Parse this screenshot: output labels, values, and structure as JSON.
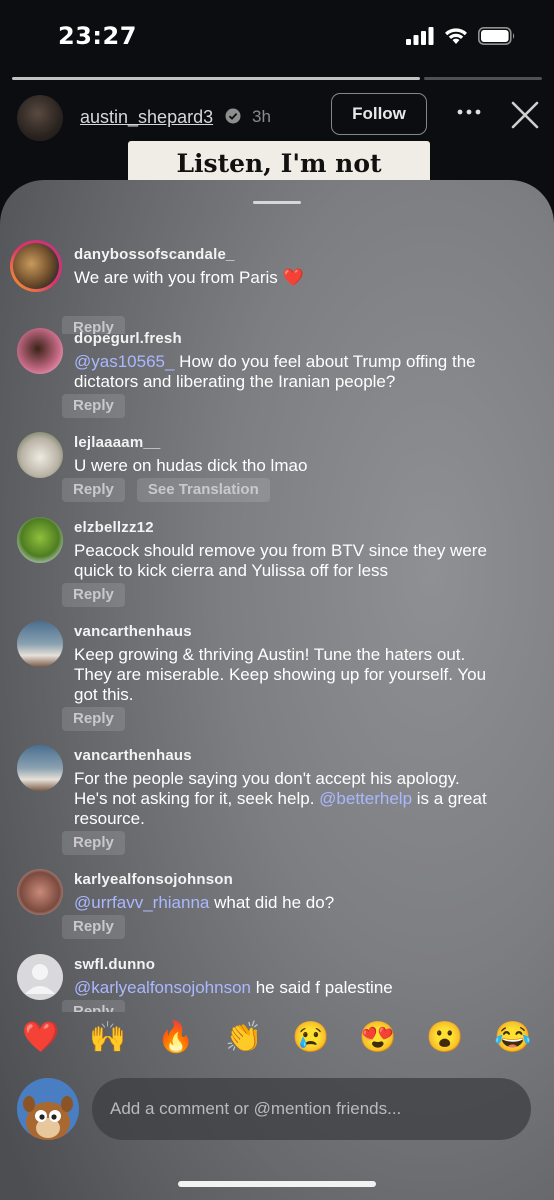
{
  "status_bar": {
    "time": "23:27"
  },
  "story": {
    "username": "austin_shepard3",
    "age": "3h",
    "follow_label": "Follow",
    "card_text": "Listen, I'm not perfect."
  },
  "comments": [
    {
      "user": "danybossofscandale_",
      "mention": "",
      "text": "We are with you from Paris ❤️",
      "reply": "Reply",
      "translate": ""
    },
    {
      "user": "dopegurl.fresh",
      "mention": "@yas10565_",
      "text": " How do you feel about Trump offing the dictators and liberating the Iranian people?",
      "reply": "Reply",
      "translate": ""
    },
    {
      "user": "lejlaaaam__",
      "mention": "",
      "text": "U were on hudas dick tho lmao",
      "reply": "Reply",
      "translate": "See Translation"
    },
    {
      "user": "elzbellzz12",
      "mention": "",
      "text": "Peacock should remove you from BTV since they were quick to kick cierra and Yulissa off for less",
      "reply": "Reply",
      "translate": ""
    },
    {
      "user": "vancarthenhaus",
      "mention": "",
      "text": "Keep growing & thriving Austin! Tune the haters out. They are miserable. Keep showing up for yourself. You got this.",
      "reply": "Reply",
      "translate": ""
    },
    {
      "user": "vancarthenhaus",
      "mention": "",
      "text": "For the people saying you don't accept his apology. He's not asking for it, seek help. ",
      "mention2": "@betterhelp",
      "text2": " is a great resource.",
      "reply": "Reply",
      "translate": ""
    },
    {
      "user": "karlyealfonsojohnson",
      "mention": "@urrfavv_rhianna",
      "text": " what did he do?",
      "reply": "Reply",
      "translate": ""
    },
    {
      "user": "swfl.dunno",
      "mention": "@karlyealfonsojohnson",
      "text": " he said f palestine",
      "reply": "Reply",
      "translate": ""
    }
  ],
  "reactions": [
    "❤️",
    "🙌",
    "🔥",
    "👏",
    "😢",
    "😍",
    "😮",
    "😂"
  ],
  "composer": {
    "placeholder": "Add a comment or @mention friends..."
  }
}
